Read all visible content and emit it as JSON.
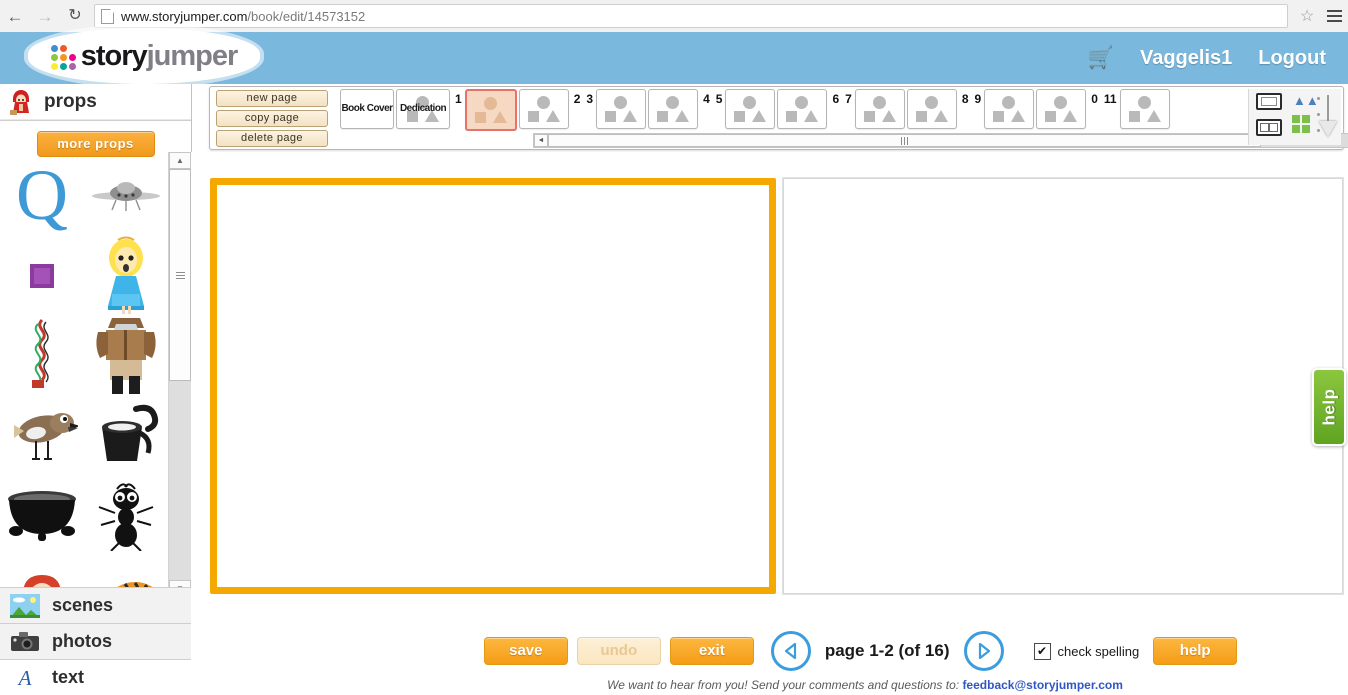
{
  "browser": {
    "back_icon": "back-arrow-icon",
    "forward_icon": "forward-arrow-icon",
    "reload_icon": "reload-icon",
    "url_host": "www.storyjumper.com",
    "url_path": "/book/edit/14573152",
    "star_glyph": "☆",
    "page_icon": "page-icon"
  },
  "header": {
    "logo_part1": "story",
    "logo_part2": "jumper",
    "logo_dot_colors": [
      "#3d8fd1",
      "#f05a28",
      "#ffffff",
      "#8dc63f",
      "#f7941e",
      "#ec008c",
      "#f9ed32",
      "#00a79d",
      "#a864a8"
    ],
    "cart_glyph": "🛒",
    "username": "Vaggelis1",
    "logout": "Logout",
    "background": "#7ab8dd"
  },
  "sidebar": {
    "panel_title": "props",
    "panel_icon": "red-riding-hood-icon",
    "more_button": "more props",
    "props": [
      {
        "name": "prop-letter-q",
        "kind": "letter-q"
      },
      {
        "name": "prop-ufo",
        "kind": "ufo"
      },
      {
        "name": "prop-purple-square",
        "kind": "purple-square"
      },
      {
        "name": "prop-girl-blue-dress",
        "kind": "girl"
      },
      {
        "name": "prop-ribbon-streamer",
        "kind": "ribbon"
      },
      {
        "name": "prop-man-brown-jacket",
        "kind": "man"
      },
      {
        "name": "prop-bird",
        "kind": "bird"
      },
      {
        "name": "prop-watering-can",
        "kind": "watering-can"
      },
      {
        "name": "prop-cauldron",
        "kind": "cauldron"
      },
      {
        "name": "prop-ant",
        "kind": "ant"
      },
      {
        "name": "prop-red-haired-girl",
        "kind": "red-girl"
      },
      {
        "name": "prop-tiger",
        "kind": "tiger"
      }
    ],
    "items": [
      {
        "label": "scenes",
        "icon": "landscape-icon"
      },
      {
        "label": "photos",
        "icon": "camera-icon"
      },
      {
        "label": "text",
        "icon": "text-a-icon"
      }
    ],
    "scroll_up_glyph": "▲",
    "scroll_down_glyph": "▼"
  },
  "toolbar": {
    "page_ops": [
      "new page",
      "copy page",
      "delete page"
    ],
    "thumbnails": [
      {
        "type": "label",
        "label": "Book Cover",
        "number": "",
        "selected": false,
        "name": "thumb-book-cover"
      },
      {
        "type": "label",
        "label": "Dedication",
        "number": "",
        "selected": false,
        "name": "thumb-dedication"
      },
      {
        "type": "shapes",
        "label": "",
        "number": "1",
        "number_side": "left",
        "selected": true,
        "name": "thumb-page-1"
      },
      {
        "type": "shapes",
        "label": "",
        "number": "2",
        "number_side": "right",
        "selected": false,
        "name": "thumb-page-2"
      },
      {
        "type": "shapes",
        "label": "",
        "number": "3",
        "number_side": "left",
        "selected": false,
        "name": "thumb-page-3"
      },
      {
        "type": "shapes",
        "label": "",
        "number": "4",
        "number_side": "right",
        "selected": false,
        "name": "thumb-page-4"
      },
      {
        "type": "shapes",
        "label": "",
        "number": "5",
        "number_side": "left",
        "selected": false,
        "name": "thumb-page-5"
      },
      {
        "type": "shapes",
        "label": "",
        "number": "6",
        "number_side": "right",
        "selected": false,
        "name": "thumb-page-6"
      },
      {
        "type": "shapes",
        "label": "",
        "number": "7",
        "number_side": "left",
        "selected": false,
        "name": "thumb-page-7"
      },
      {
        "type": "shapes",
        "label": "",
        "number": "8",
        "number_side": "right",
        "selected": false,
        "name": "thumb-page-8"
      },
      {
        "type": "shapes",
        "label": "",
        "number": "9",
        "number_side": "left",
        "selected": false,
        "name": "thumb-page-9"
      },
      {
        "type": "shapes",
        "label": "",
        "number": "0",
        "number_side": "right",
        "selected": false,
        "name": "thumb-page-10"
      },
      {
        "type": "shapes",
        "label": "",
        "number": "11",
        "number_side": "left",
        "selected": false,
        "name": "thumb-page-11"
      }
    ],
    "scroll_left_glyph": "◄",
    "scroll_right_glyph": "►",
    "view_single_icon": "single-page-view-icon",
    "view_spread_icon": "spread-view-icon",
    "sort_icon": "sort-icon",
    "grid_icon": "grid-arrange-icon",
    "zoom_slider": "thumbnail-zoom-slider"
  },
  "canvas": {
    "left_page_border_color": "#f5a800",
    "left_page_name": "book-page-left",
    "right_page_name": "book-page-right"
  },
  "bottom": {
    "save": "save",
    "undo": "undo",
    "exit": "exit",
    "prev_icon": "previous-page-arrow-icon",
    "next_icon": "next-page-arrow-icon",
    "page_label": "page 1-2 (of 16)",
    "check_spelling": "check spelling",
    "check_mark": "✔",
    "help": "help",
    "footer_text": "We want to hear from you! Send your comments and questions to:",
    "footer_email": "feedback@storyjumper.com"
  },
  "help_tab": {
    "label": "help",
    "color": "#8cc63f"
  }
}
